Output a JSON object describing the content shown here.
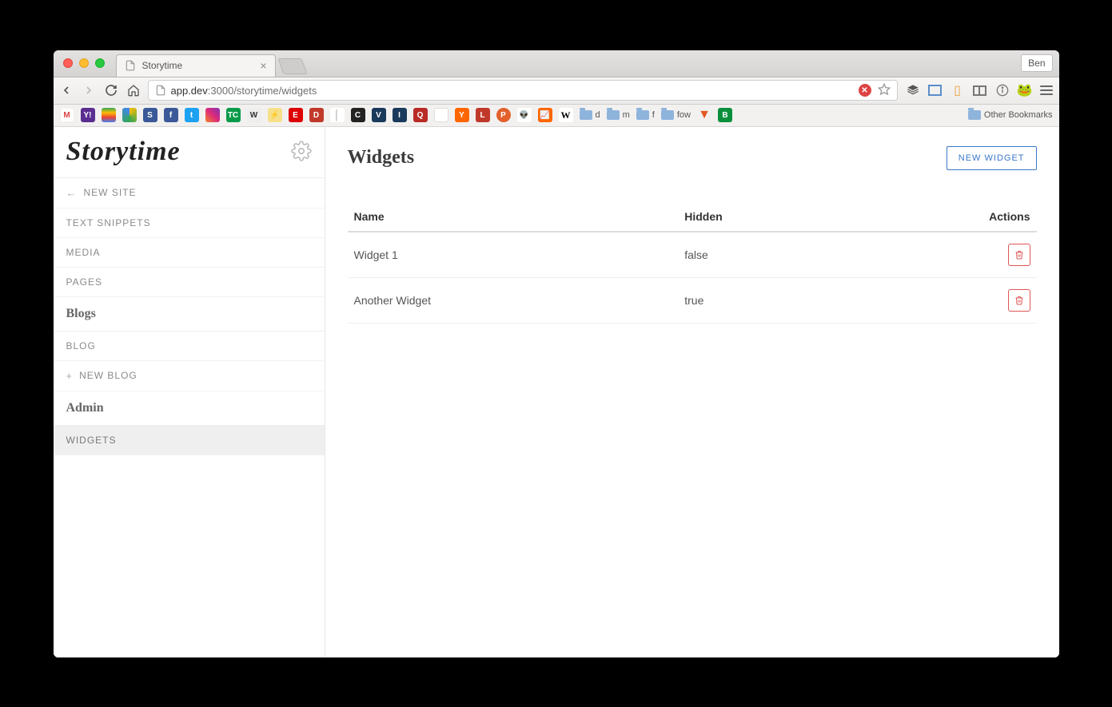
{
  "browser": {
    "tab_title": "Storytime",
    "profile": "Ben",
    "url": {
      "host": "app.dev",
      "port": ":3000",
      "path": "/storytime/widgets"
    },
    "other_bookmarks_label": "Other Bookmarks",
    "bookmark_folders": [
      "d",
      "m",
      "f",
      "fow"
    ]
  },
  "sidebar": {
    "brand": "Storytime",
    "items": [
      {
        "label": "NEW SITE",
        "icon": "arrow-left"
      },
      {
        "label": "TEXT SNIPPETS"
      },
      {
        "label": "MEDIA"
      },
      {
        "label": "PAGES"
      }
    ],
    "blogs_section": "Blogs",
    "blog_items": [
      {
        "label": "BLOG"
      },
      {
        "label": "NEW BLOG",
        "icon": "plus"
      }
    ],
    "admin_section": "Admin",
    "admin_items": [
      {
        "label": "WIDGETS",
        "active": true
      }
    ]
  },
  "main": {
    "title": "Widgets",
    "new_button": "NEW WIDGET",
    "columns": {
      "name": "Name",
      "hidden": "Hidden",
      "actions": "Actions"
    },
    "rows": [
      {
        "name": "Widget 1",
        "hidden": "false"
      },
      {
        "name": "Another Widget",
        "hidden": "true"
      }
    ]
  }
}
